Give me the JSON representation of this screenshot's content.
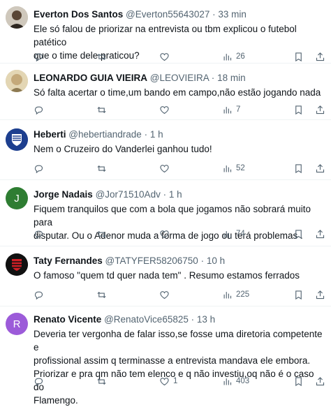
{
  "tweets": [
    {
      "name": "Everton Dos Santos",
      "handle": "@Everton55643027",
      "dot": "·",
      "time": "33 min",
      "lines": [
        "Ele só falou de priorizar na entrevista ou tbm explicou o futebol patético",
        "que o time dele praticou?"
      ],
      "replies": "",
      "retweets": "",
      "likes": "",
      "views": "26",
      "avatar": {
        "kind": "photo",
        "colors": [
          "#c9c2b6",
          "#3a2f2a"
        ]
      }
    },
    {
      "name": "LEONARDO GUIA VIEIRA",
      "handle": "@LEOVIEIRA",
      "dot": "·",
      "time": "18 min",
      "lines": [
        "Só falta acertar o time,um bando em campo,não estão jogando nada"
      ],
      "replies": "",
      "retweets": "",
      "likes": "",
      "views": "7",
      "avatar": {
        "kind": "photo",
        "colors": [
          "#d8c8a3",
          "#8d7a52"
        ]
      }
    },
    {
      "name": "Heberti",
      "handle": "@hebertiandrade",
      "dot": "·",
      "time": "1 h",
      "lines": [
        "Nem o Cruzeiro do Vanderlei ganhou tudo!"
      ],
      "replies": "",
      "retweets": "",
      "likes": "",
      "views": "52",
      "avatar": {
        "kind": "crest",
        "colors": [
          "#1d3f8f",
          "#ffffff"
        ]
      }
    },
    {
      "name": "Jorge Nadais",
      "handle": "@Jor71510Adv",
      "dot": "·",
      "time": "1 h",
      "lines": [
        "Fiquem tranquilos que com a bola que jogamos não sobrará muito para",
        "disputar. Ou o Adenor muda a forma de jogo ou terá problemas ."
      ],
      "replies": "",
      "retweets": "",
      "likes": "",
      "views": "74",
      "avatar": {
        "kind": "letter",
        "letter": "J",
        "colors": [
          "#2e7d32"
        ]
      }
    },
    {
      "name": "Taty Fernandes",
      "handle": "@TATYFER58206750",
      "dot": "·",
      "time": "10 h",
      "lines": [
        "O famoso \"quem td quer nada tem\" . Resumo estamos ferrados"
      ],
      "replies": "",
      "retweets": "",
      "likes": "",
      "views": "225",
      "avatar": {
        "kind": "flamengo",
        "colors": [
          "#111111",
          "#d21f26"
        ]
      }
    },
    {
      "name": "Renato Vicente",
      "handle": "@RenatoVice65825",
      "dot": "·",
      "time": "13 h",
      "lines": [
        "Deveria ter vergonha de falar isso,se fosse uma diretoria competente e",
        "profissional assim q terminasse a entrevista mandava ele embora.",
        "Priorizar e pra qm não tem elenco e q não investiu,oq não é o caso do",
        "Flamengo."
      ],
      "replies": "",
      "retweets": "",
      "likes": "1",
      "views": "403",
      "avatar": {
        "kind": "letter",
        "letter": "R",
        "colors": [
          "#9c5bd9"
        ]
      }
    }
  ]
}
